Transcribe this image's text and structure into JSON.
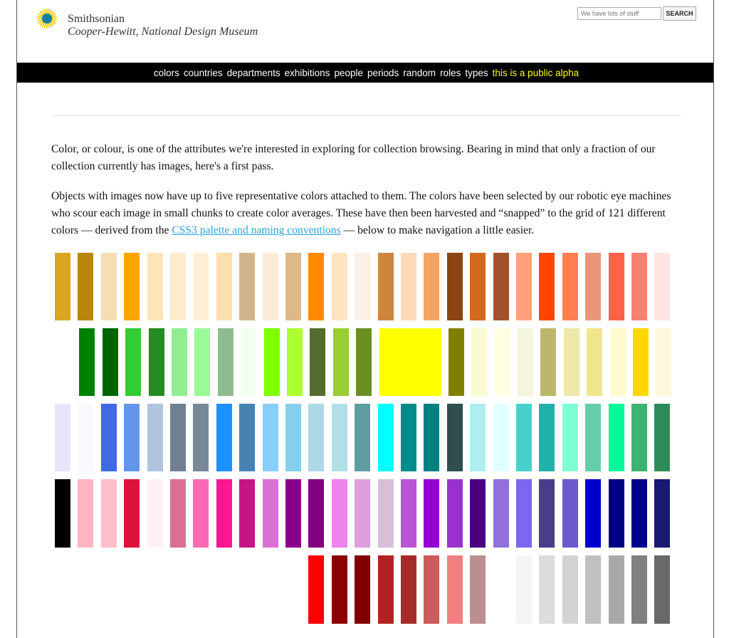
{
  "brand": {
    "name": "Smithsonian",
    "subtitle": "Cooper-Hewitt, National Design Museum",
    "logo_icon": "smithsonian-sunburst-icon",
    "logo_colors": [
      "#f2c900",
      "#0c7fa8"
    ]
  },
  "search": {
    "placeholder": "We have lots of stuff",
    "button": "SEARCH"
  },
  "nav": {
    "items": [
      "colors",
      "countries",
      "departments",
      "exhibitions",
      "people",
      "periods",
      "random",
      "roles",
      "types"
    ],
    "alpha_note": "this is a public alpha"
  },
  "intro": {
    "p1": "Color, or colour, is one of the attributes we're interested in exploring for collection browsing. Bearing in mind that only a fraction of our collection currently has images, here's a first pass.",
    "p2_before": "Objects with images now have up to five representative colors attached to them. The colors have been selected by our robotic eye machines who scour each image in small chunks to create color averages. These have then been harvested and “snapped” to the grid of 121 different colors — derived from the ",
    "p2_link": "CSS3 palette and naming conventions",
    "p2_after": " — below to make navigation a little easier."
  },
  "palette": {
    "rows": [
      [
        "#daa520",
        "#b8860b",
        "#f5deb3",
        "#ffa500",
        "#ffe4b5",
        "#ffebcd",
        "#ffefd5",
        "#ffdead",
        "#d2b48c",
        "#faebd7",
        "#deb887",
        "#ff8c00",
        "#ffe4c4",
        "#faf0e6",
        "#cd853f",
        "#ffdab9",
        "#f4a460",
        "#8b4513",
        "#d2691e",
        "#a0522d",
        "#ffa07a",
        "#ff4500",
        "#ff7f50",
        "#e9967a",
        "#ff6347",
        "#fa8072",
        "#ffe4e1"
      ],
      [
        "#008000",
        "#006400",
        "#32cd32",
        "#228b22",
        "#90ee90",
        "#98fb98",
        "#8fbc8f",
        "#f0fff0",
        "#7fff00",
        "#adff2f",
        "#556b2f",
        "#9acd32",
        "#6b8e23",
        "#ffff00",
        "#808000",
        "#fafad2",
        "#ffffe0",
        "#f5f5dc",
        "#bdb76b",
        "#eee8aa",
        "#f0e68c",
        "#fffacd",
        "#ffd700",
        "#fff8dc"
      ],
      [
        "#e6e6fa",
        "#f8f8ff",
        "#4169e1",
        "#6495ed",
        "#b0c4de",
        "#708090",
        "#778899",
        "#1e90ff",
        "#4682b4",
        "#87cefa",
        "#87ceeb",
        "#add8e6",
        "#b0e0e6",
        "#5f9ea0",
        "#00ffff",
        "#008b8b",
        "#008080",
        "#2f4f4f",
        "#afeeee",
        "#e0ffff",
        "#48d1cc",
        "#20b2aa",
        "#7fffd4",
        "#66cdaa",
        "#00fa9a",
        "#3cb371",
        "#2e8b57"
      ],
      [
        "#000000",
        "#ffb6c1",
        "#ffc0cb",
        "#dc143c",
        "#fff0f5",
        "#db7093",
        "#ff69b4",
        "#ff1493",
        "#c71585",
        "#da70d6",
        "#8b008b",
        "#800080",
        "#ee82ee",
        "#dda0dd",
        "#d8bfd8",
        "#ba55d3",
        "#9400d3",
        "#9932cc",
        "#4b0082",
        "#9370db",
        "#7b68ee",
        "#483d8b",
        "#6a5acd",
        "#0000cd",
        "#000080",
        "#00008b",
        "#191970"
      ],
      [
        "#ff0000",
        "#8b0000",
        "#800000",
        "#b22222",
        "#a52a2a",
        "#cd5c5c",
        "#f08080",
        "#bc8f8f",
        "#ffffff",
        "#f5f5f5",
        "#dcdcdc",
        "#d3d3d3",
        "#c0c0c0",
        "#a9a9a9",
        "#808080",
        "#696969"
      ]
    ]
  }
}
